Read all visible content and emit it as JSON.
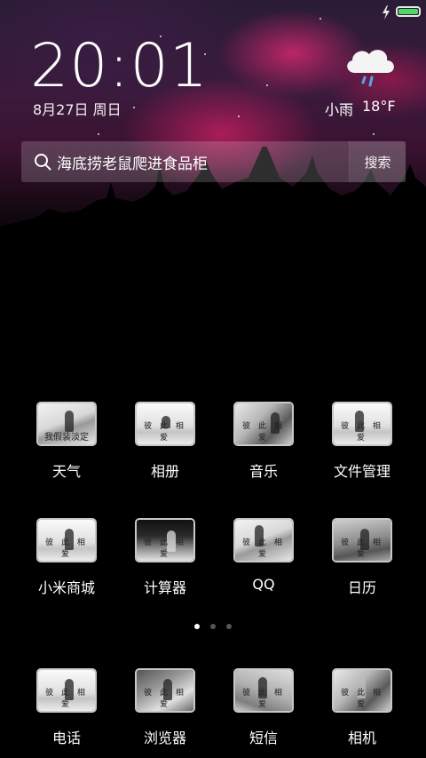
{
  "status_bar": {
    "charging_icon": "lightning-bolt-icon",
    "battery_icon": "battery-icon",
    "battery_level": 1.0,
    "battery_color": "#4cd964"
  },
  "clock_widget": {
    "time": "20:01",
    "date": "8月27日 周日"
  },
  "weather_widget": {
    "icon": "rain-cloud-icon",
    "condition": "小雨",
    "temperature": "18°F"
  },
  "search_bar": {
    "icon": "search-icon",
    "query": "海底捞老鼠爬进食品柜",
    "button_label": "搜索"
  },
  "apps": [
    {
      "label": "天气",
      "overlay": "我假装淡定"
    },
    {
      "label": "相册",
      "overlay": "彼 此 相 爱"
    },
    {
      "label": "音乐",
      "overlay": "彼 此 相 爱"
    },
    {
      "label": "文件管理",
      "overlay": "彼 此 相 爱"
    },
    {
      "label": "小米商城",
      "overlay": "彼 此 相 爱"
    },
    {
      "label": "计算器",
      "overlay": "彼 此 相 爱"
    },
    {
      "label": "QQ",
      "overlay": "彼 此 相 爱"
    },
    {
      "label": "日历",
      "overlay": "彼 此 相 爱"
    }
  ],
  "page_indicator": {
    "count": 3,
    "active_index": 0
  },
  "dock": [
    {
      "label": "电话",
      "overlay": "彼 此 相 爱"
    },
    {
      "label": "浏览器",
      "overlay": "彼 此 相 爱"
    },
    {
      "label": "短信",
      "overlay": "彼 此 相 爱"
    },
    {
      "label": "相机",
      "overlay": "彼 此 相 爱"
    }
  ],
  "colors": {
    "wallpaper_accent": "#c8286e",
    "background": "#000000"
  }
}
